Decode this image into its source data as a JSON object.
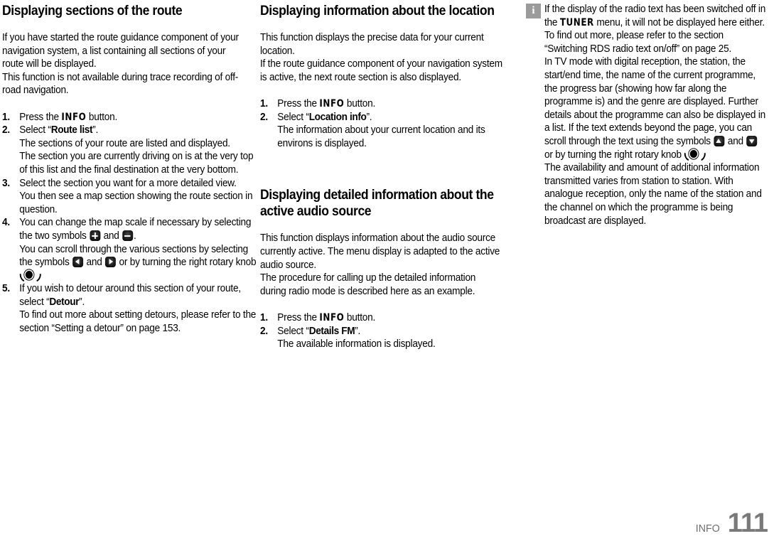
{
  "page": {
    "footer": {
      "chapter_label": "INFO",
      "page_number": "111"
    }
  },
  "columns": [
    {
      "id": "column-1",
      "heading": "Displaying sections of the route",
      "intro": [
        "If you have started the route guidance component of your navigation system, a list containing all sections of your route will be displayed.",
        "This function is not available during trace recording of off-road navigation."
      ],
      "steps": [
        {
          "num": "1.",
          "parts": [
            {
              "type": "text",
              "value": "Press the "
            },
            {
              "type": "device-button",
              "value": "INFO"
            },
            {
              "type": "text",
              "value": "  button."
            }
          ],
          "subs": []
        },
        {
          "num": "2.",
          "parts": [
            {
              "type": "text",
              "value": "Select “"
            },
            {
              "type": "menu-item",
              "value": "Route list"
            },
            {
              "type": "text",
              "value": "”."
            }
          ],
          "subs": [
            "The sections of your route are listed and displayed.",
            "The section you are currently driving on is at the very top of this list and the final destination at the very bottom."
          ]
        },
        {
          "num": "3.",
          "parts": [
            {
              "type": "text",
              "value": "Select the section you want for a more detailed view."
            }
          ],
          "subs": [
            "You then see a map section showing the route section in question."
          ]
        },
        {
          "num": "4.",
          "parts": [
            {
              "type": "text",
              "value": "You can change the map scale if necessary by selecting the two symbols "
            },
            {
              "type": "chip",
              "value": "plus-icon"
            },
            {
              "type": "text",
              "value": " and "
            },
            {
              "type": "chip",
              "value": "minus-icon"
            },
            {
              "type": "text",
              "value": "."
            }
          ],
          "subs_rich": [
            [
              {
                "type": "text",
                "value": "You can scroll through the various sections by selecting the symbols "
              },
              {
                "type": "chip",
                "value": "left-arrow-icon"
              },
              {
                "type": "text",
                "value": " and "
              },
              {
                "type": "chip",
                "value": "right-arrow-icon"
              },
              {
                "type": "text",
                "value": " or by turning the right rotary knob "
              },
              {
                "type": "knob",
                "value": "rotary-knob-icon"
              },
              {
                "type": "text",
                "value": "."
              }
            ]
          ],
          "subs": []
        },
        {
          "num": "5.",
          "parts": [
            {
              "type": "text",
              "value": "If you wish to detour around this section of your route, select “"
            },
            {
              "type": "menu-item",
              "value": "Detour"
            },
            {
              "type": "text",
              "value": "”."
            }
          ],
          "subs": [
            "To find out more about setting detours, please refer to the section “Setting a detour” on page 153."
          ]
        }
      ]
    },
    {
      "id": "column-2",
      "heading": "Displaying information about the location",
      "intro": [
        "This function displays the precise data for your current location.",
        "If the route guidance component of your navigation system is active, the next route section is also displayed."
      ],
      "steps": [
        {
          "num": "1.",
          "parts": [
            {
              "type": "text",
              "value": "Press the "
            },
            {
              "type": "device-button",
              "value": "INFO"
            },
            {
              "type": "text",
              "value": "  button."
            }
          ],
          "subs": []
        },
        {
          "num": "2.",
          "parts": [
            {
              "type": "text",
              "value": "Select “"
            },
            {
              "type": "menu-item",
              "value": "Location info"
            },
            {
              "type": "text",
              "value": "”."
            }
          ],
          "subs": [
            "The information about your current location and its environs is displayed."
          ]
        }
      ],
      "heading2": "Displaying detailed information about the active audio source",
      "intro2": [
        "This function displays information about the audio source currently active. The menu display is adapted to the active audio source.",
        "The procedure for calling up the detailed information during radio mode is described here as an example."
      ],
      "steps2": [
        {
          "num": "1.",
          "parts": [
            {
              "type": "text",
              "value": "Press the "
            },
            {
              "type": "device-button",
              "value": "INFO"
            },
            {
              "type": "text",
              "value": "  button."
            }
          ],
          "subs": []
        },
        {
          "num": "2.",
          "parts": [
            {
              "type": "text",
              "value": "Select “"
            },
            {
              "type": "menu-item",
              "value": "Details FM"
            },
            {
              "type": "text",
              "value": "”."
            }
          ],
          "subs": [
            "The available information is displayed."
          ]
        }
      ]
    },
    {
      "id": "column-3",
      "note_icon_glyph": "i",
      "note_paragraphs_rich": [
        [
          {
            "type": "text",
            "value": "If the display of the radio text has been switched off in the "
          },
          {
            "type": "device-button",
            "value": "TUNER"
          },
          {
            "type": "text",
            "value": " menu, it will not be displayed here either. To find out more, please refer to the section “Switching RDS radio text on/off” on page 25."
          }
        ],
        [
          {
            "type": "text",
            "value": "In TV mode with digital reception, the station, the start/end time, the name of the current programme, the progress bar (showing how far along the programme is) and the genre are displayed. Further details about the programme can also be displayed in a list. If the text extends beyond the page, you can scroll through the text using the symbols "
          },
          {
            "type": "chip",
            "value": "up-arrow-icon"
          },
          {
            "type": "text",
            "value": " and "
          },
          {
            "type": "chip",
            "value": "down-arrow-icon"
          },
          {
            "type": "text",
            "value": " or by turning the right rotary knob "
          },
          {
            "type": "knob",
            "value": "rotary-knob-icon"
          },
          {
            "type": "text",
            "value": "."
          }
        ],
        [
          {
            "type": "text",
            "value": "The availability and amount of additional information transmitted varies from station to station. With analogue reception, only the name of the station and the channel on which the programme is being broadcast are displayed."
          }
        ]
      ]
    }
  ],
  "colors": {
    "text": "#000000",
    "note_icon_bg": "#9b9b9b",
    "footer_gray": "#7a7a7a",
    "chip_bg": "#111111"
  }
}
